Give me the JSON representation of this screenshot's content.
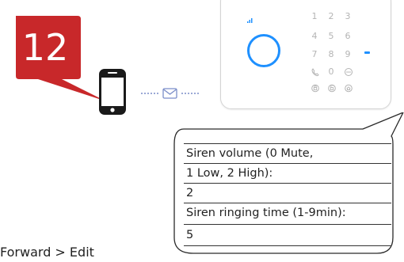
{
  "step": {
    "number": "12",
    "color": "#c8282a"
  },
  "keypad": {
    "keys": [
      "1",
      "2",
      "3",
      "4",
      "5",
      "6",
      "7",
      "8",
      "9",
      "0"
    ],
    "icons": [
      "phone-icon",
      "voice-icon",
      "lock-icon",
      "unlock-icon",
      "home-icon"
    ],
    "ring_color": "#1e90ff",
    "led_color": "#1e90ff"
  },
  "phone": {
    "icon": "smartphone-icon"
  },
  "sms": {
    "icon": "envelope-icon",
    "accent": "#7b8ec9"
  },
  "bubble": {
    "rows": [
      "Siren volume (0 Mute,",
      "1 Low, 2 High):",
      "2",
      "Siren ringing time (1-9min):",
      "5"
    ]
  },
  "caption": {
    "text": "Forward > Edit"
  }
}
